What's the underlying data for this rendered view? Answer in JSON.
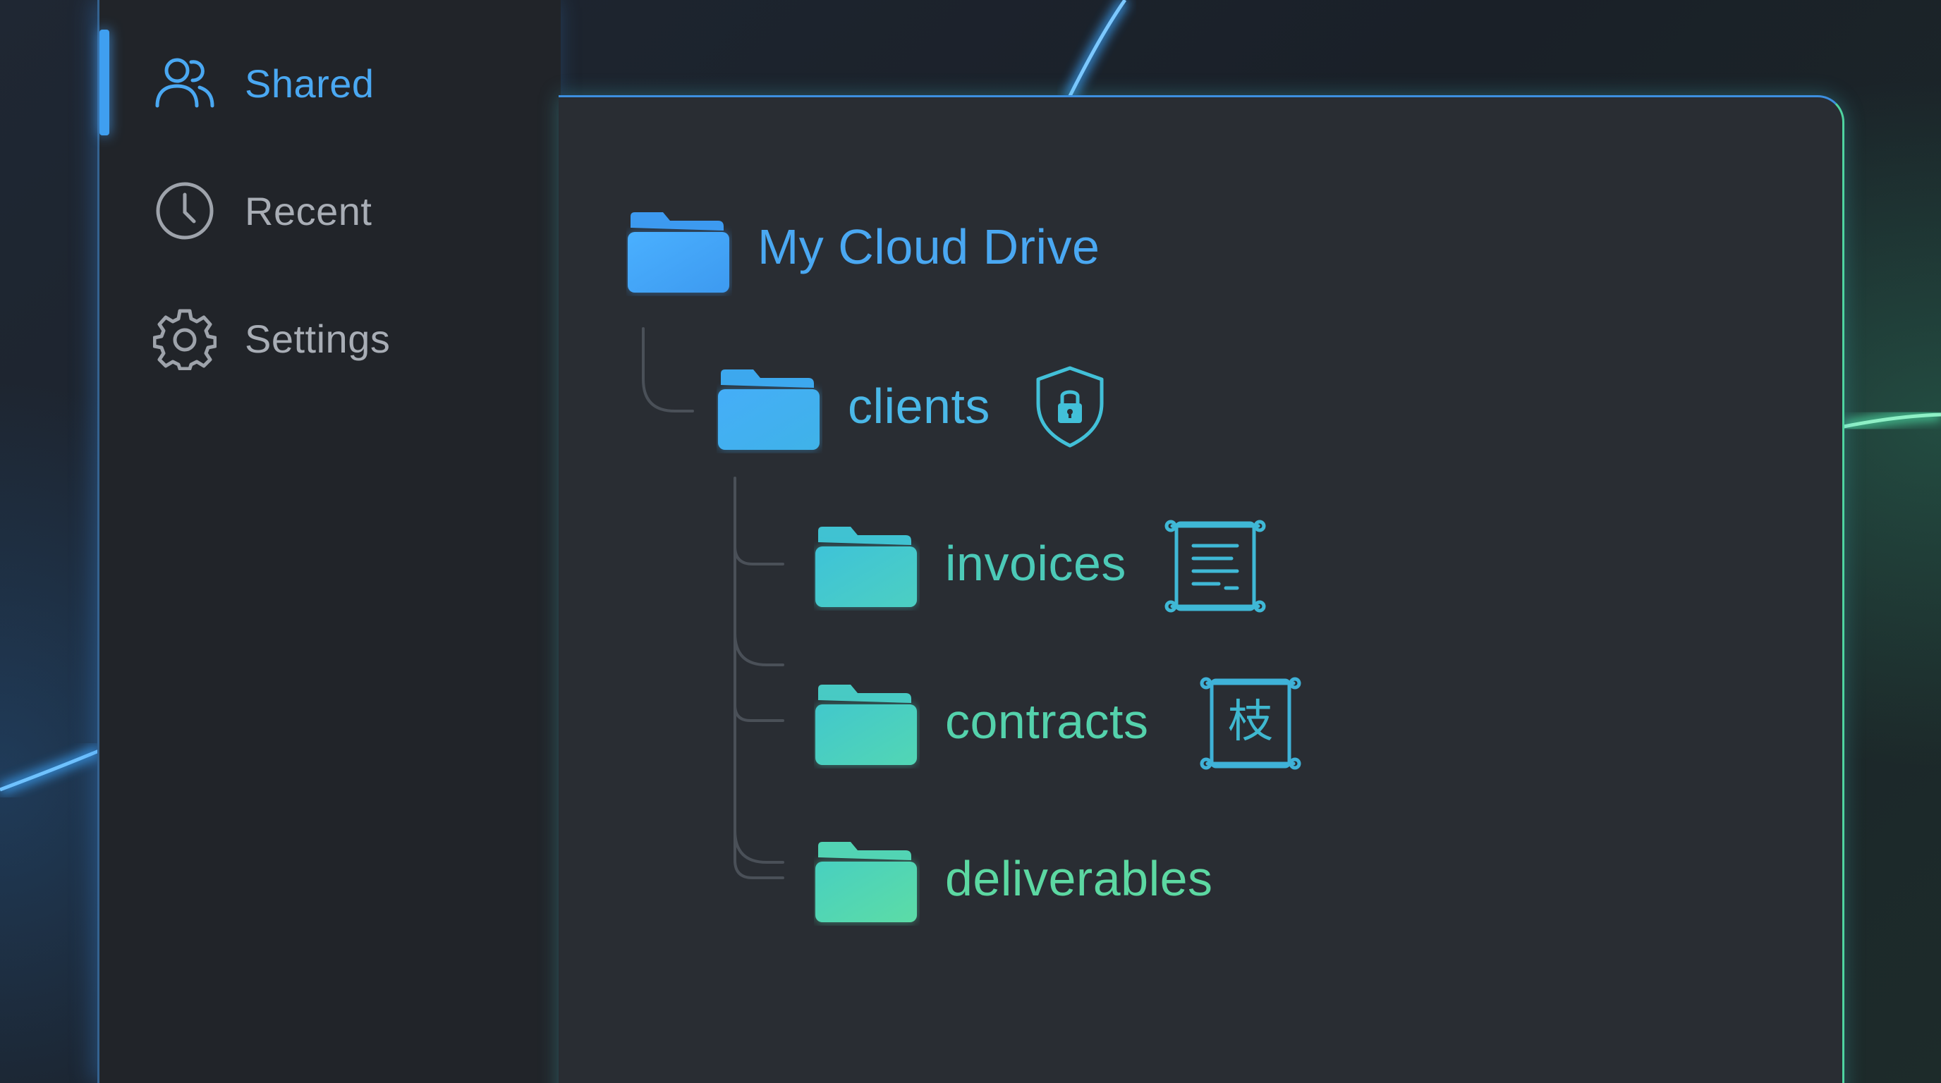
{
  "sidebar": {
    "items": [
      {
        "label": "Shared",
        "icon": "users-icon",
        "active": true
      },
      {
        "label": "Recent",
        "icon": "clock-icon",
        "active": false
      },
      {
        "label": "Settings",
        "icon": "gear-icon",
        "active": false
      }
    ]
  },
  "tree": {
    "root": {
      "label": "My Cloud Drive",
      "icon": "folder-icon"
    },
    "clients": {
      "label": "clients",
      "icon": "folder-icon",
      "badge": "shield-lock-icon"
    },
    "children": [
      {
        "label": "invoices",
        "icon": "folder-icon",
        "badge": "scroll-document-icon"
      },
      {
        "label": "contracts",
        "icon": "folder-icon",
        "badge": "scroll-kanji-icon",
        "badge_glyph": "枝"
      },
      {
        "label": "deliverables",
        "icon": "folder-icon"
      }
    ]
  },
  "colors": {
    "accent_blue": "#4aa8f2",
    "accent_teal": "#45c9c0",
    "accent_green": "#5fdca8",
    "sidebar_bg": "#212429",
    "panel_bg": "#292d33",
    "inactive_text": "#a8adb5"
  }
}
